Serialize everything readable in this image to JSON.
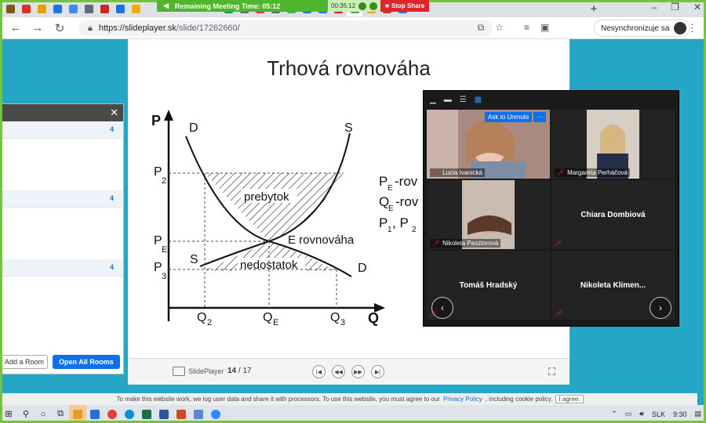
{
  "tabs": {
    "favicon_colors": [
      "#7a5a10",
      "#d93025",
      "#e8a000",
      "#1a73e8",
      "#4285f4",
      "#5b6b7c",
      "#c62828",
      "#1a73e8",
      "#f9ab00",
      "#0f9d58",
      "#5b6b7c",
      "#e53935",
      "#5b6b7c",
      "#4caf50",
      "#1a73e8",
      "#1877f2",
      "#ff0000",
      "#34a853",
      "#e8a000",
      "#d93025",
      "#1a73e8"
    ],
    "new_tab_label": "+"
  },
  "meeting": {
    "timer_label": "Remaining Meeting Time: 05:12",
    "elapsed": "00:35:12",
    "stop_label": "Stop Share"
  },
  "address": {
    "host": "https://slideplayer.sk",
    "path": "/slide/17262660/",
    "sync_label": "Nesynchronizuje sa"
  },
  "slide": {
    "title": "Trhová rovnováha",
    "labels": {
      "p_axis": "P",
      "q_axis": "Q",
      "d_top": "D",
      "s_top": "S",
      "p2": "P",
      "p2_sub": "2",
      "pe": "P",
      "pe_sub": "E",
      "p3": "P",
      "p3_sub": "3",
      "s_low": "S",
      "d_low": "D",
      "q2": "Q",
      "q2_sub": "2",
      "qe": "Q",
      "qe_sub": "E",
      "q3": "Q",
      "q3_sub": "3",
      "prebytok": "prebytok",
      "rovnovaha": "E rovnováha",
      "nedostatok": "nedostatok",
      "side1": "-rov",
      "side1_var": "P",
      "side1_sub": "E",
      "side2": "-rov",
      "side2_var": "Q",
      "side2_sub": "E",
      "side3": "P",
      "side3_sub": "1",
      "side3_mid": ", P",
      "side3_sub2": "2"
    }
  },
  "player": {
    "brand": "SlidePlayer",
    "page_current": "14",
    "page_sep": " / ",
    "page_total": "17"
  },
  "rooms": {
    "counts": [
      "4",
      "4",
      "4"
    ],
    "add_label": "Add a Room",
    "open_label": "Open All Rooms"
  },
  "gallery": {
    "ask_unmute": "Ask to Unmute",
    "more": "···",
    "participants": [
      {
        "name": "Lucia Ivanická"
      },
      {
        "name": "Margaréta Perháčová"
      },
      {
        "name": "Nikoleta Pasztorová"
      },
      {
        "name": "Chiara Dombiová"
      },
      {
        "name": "Tomáš Hradský"
      },
      {
        "name": "Nikoleta  Klimen..."
      }
    ]
  },
  "cookie": {
    "text": "To make this website work, we log user data and share it with processors. To use this website, you must agree to our",
    "link": "Privacy Policy",
    "tail": ", including cookie policy.",
    "agree": "I agree."
  },
  "taskbar": {
    "lang": "SLK",
    "time": "9:30"
  }
}
